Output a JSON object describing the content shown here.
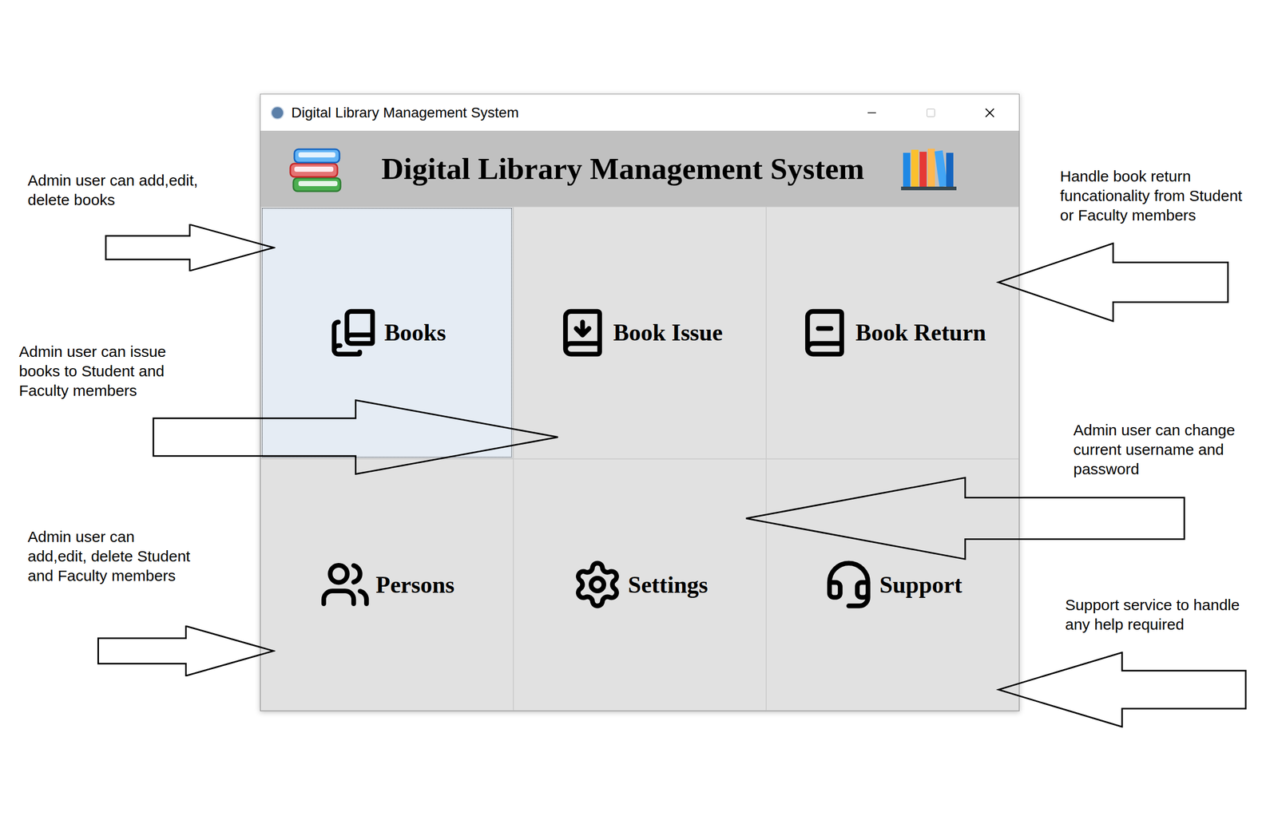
{
  "window": {
    "title": "Digital Library Management System"
  },
  "header": {
    "title": "Digital Library Management System"
  },
  "tiles": [
    {
      "label": "Books",
      "selected": true
    },
    {
      "label": "Book Issue",
      "selected": false
    },
    {
      "label": "Book Return",
      "selected": false
    },
    {
      "label": "Persons",
      "selected": false
    },
    {
      "label": "Settings",
      "selected": false
    },
    {
      "label": "Support",
      "selected": false
    }
  ],
  "annotations": [
    {
      "lines": [
        "Admin user can add,edit,",
        "delete books"
      ]
    },
    {
      "lines": [
        "Admin user can issue",
        "books to Student and",
        "Faculty members"
      ]
    },
    {
      "lines": [
        "Admin user can",
        "add,edit, delete Student",
        "and Faculty members"
      ]
    },
    {
      "lines": [
        "Handle book return",
        "funcationality from Student",
        "or Faculty members"
      ]
    },
    {
      "lines": [
        "Admin user can change",
        "current username and",
        "password"
      ]
    },
    {
      "lines": [
        "Support service to handle",
        "any help required"
      ]
    }
  ]
}
